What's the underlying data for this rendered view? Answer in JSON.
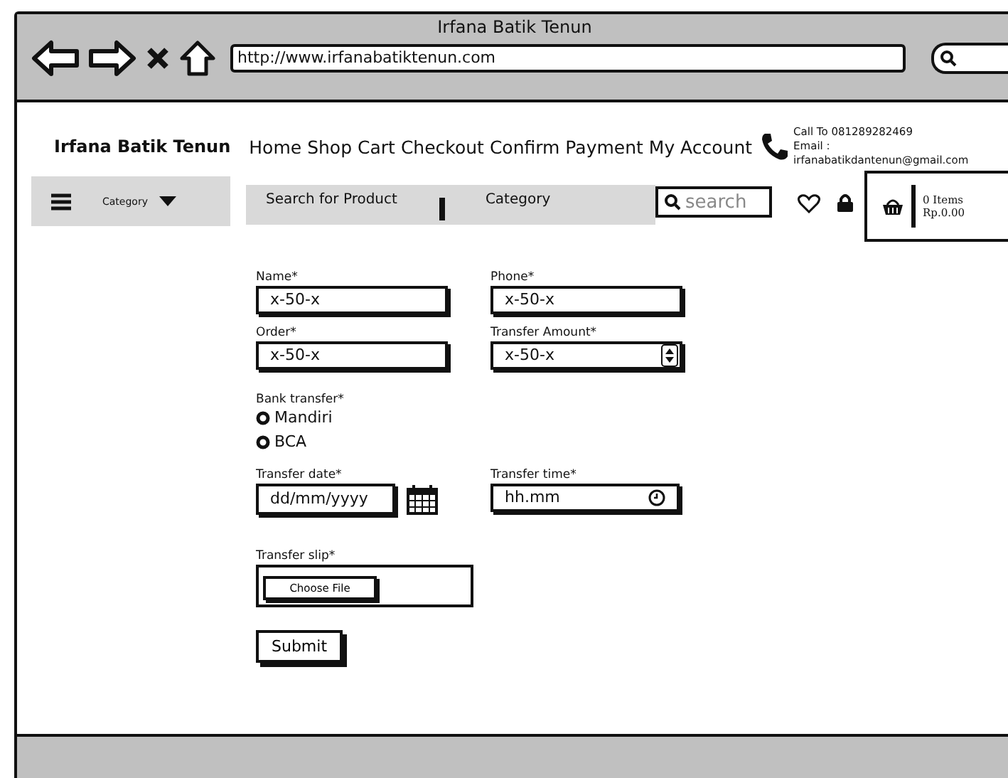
{
  "window": {
    "title": "Irfana Batik Tenun",
    "url": "http://www.irfanabatiktenun.com"
  },
  "header": {
    "brand": "Irfana Batik Tenun",
    "nav": [
      "Home",
      "Shop",
      "Cart",
      "Checkout",
      "Confirm Payment",
      "My Account"
    ],
    "call": "Call To 081289282469",
    "email_label": "Email :",
    "email": "irfanabatikdantenun@gmail.com"
  },
  "toolbar": {
    "category_menu": "Category",
    "search_placeholder": "Search for Product",
    "search_category": "Category",
    "search_button": "search",
    "cart_items": "0 Items",
    "cart_total": "Rp.0.00"
  },
  "form": {
    "rows": [
      [
        {
          "label": "Name*",
          "value": "x-50-x",
          "kind": "text"
        },
        {
          "label": "Phone*",
          "value": "x-50-x",
          "kind": "text"
        }
      ],
      [
        {
          "label": "Order*",
          "value": "x-50-x",
          "kind": "text"
        },
        {
          "label": "Transfer Amount*",
          "value": "x-50-x",
          "kind": "spinner"
        }
      ]
    ],
    "bank": {
      "label": "Bank transfer*",
      "options": [
        {
          "label": "Mandiri",
          "selected": false
        },
        {
          "label": "BCA",
          "selected": false
        }
      ]
    },
    "datetime": [
      {
        "label": "Transfer date*",
        "placeholder": "dd/mm/yyyy",
        "kind": "date"
      },
      {
        "label": "Transfer time*",
        "placeholder": "hh.mm",
        "kind": "time"
      }
    ],
    "slip": {
      "label": "Transfer slip*",
      "button": "Choose File"
    },
    "submit": "Submit"
  }
}
